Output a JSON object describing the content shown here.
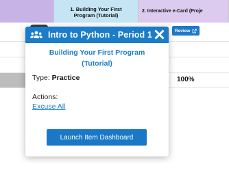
{
  "grid": {
    "columns": [
      {
        "label": "1. Building Your First Program (Tutorial)",
        "line1": "1. Building Your First",
        "line2": "Program (Tutorial)",
        "color": "#c5e4f4"
      },
      {
        "label": "2. Interactive e-Card (Proje",
        "color": "#dccbee"
      }
    ],
    "first_header_color": "#c7b3e6",
    "review_label": "Review",
    "score": "100%"
  },
  "popover": {
    "icon": "group-icon",
    "title": "Intro to Python - Period 1",
    "close_icon": "close-icon",
    "assignment_line1": "Building Your First Program",
    "assignment_line2": "(Tutorial)",
    "type_label": "Type:",
    "type_value": "Practice",
    "actions_label": "Actions:",
    "excuse_all_label": "Excuse All",
    "launch_label": "Launch Item Dashboard",
    "accent_color": "#1b7cc9"
  }
}
